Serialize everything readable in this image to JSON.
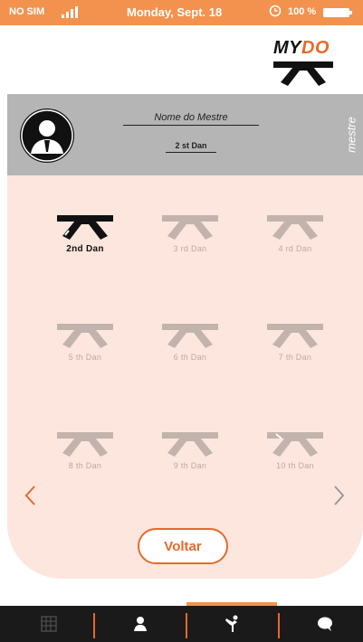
{
  "status_bar": {
    "carrier": "NO SIM",
    "date": "Monday, Sept. 18",
    "battery": "100 %"
  },
  "logo": {
    "my": "MY",
    "do": "DO"
  },
  "master": {
    "name": "Nome do Mestre",
    "rank": "2 st Dan",
    "role": "mestre"
  },
  "belts": [
    {
      "label": "2nd Dan",
      "active": true
    },
    {
      "label": "3 rd Dan",
      "active": false
    },
    {
      "label": "4  rd Dan",
      "active": false
    },
    {
      "label": "5  th Dan",
      "active": false
    },
    {
      "label": "6  th Dan",
      "active": false
    },
    {
      "label": "7  th Dan",
      "active": false
    },
    {
      "label": "8  th Dan",
      "active": false
    },
    {
      "label": "9  th Dan",
      "active": false
    },
    {
      "label": "10 th Dan",
      "active": false
    }
  ],
  "actions": {
    "back": "Voltar"
  },
  "bottom_nav": {
    "items": [
      "grid-icon",
      "person-icon",
      "martial-arts-icon",
      "chat-icon"
    ],
    "active_index": 2
  },
  "colors": {
    "accent": "#f3924e",
    "accent_dark": "#e56a2b",
    "panel": "#fde6dd",
    "header": "#b5b5b5",
    "belt_inactive": "#c2b3ad",
    "belt_active": "#111111"
  }
}
